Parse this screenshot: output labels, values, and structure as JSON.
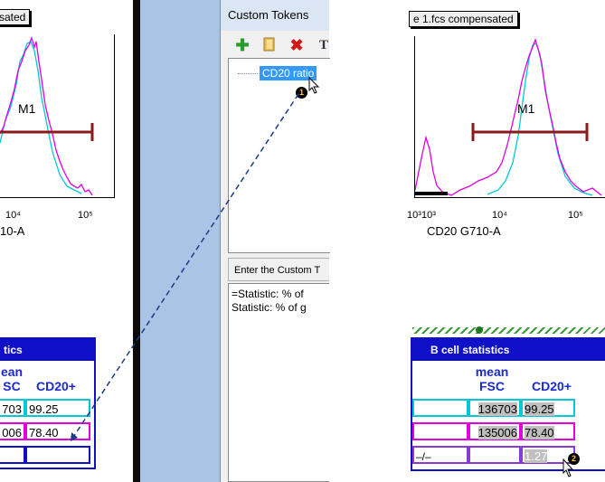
{
  "left_panel": {
    "label_text": "sated",
    "gate_label": "M1",
    "ticks": [
      "10⁴",
      "10⁵"
    ],
    "axis_label": "10-A",
    "stats": {
      "title": "tics",
      "col1": "ean\nSC",
      "col2": "CD20+",
      "rows": [
        {
          "c1": "703",
          "c2": "99.25"
        },
        {
          "c1": "006",
          "c2": "78.40"
        },
        {
          "c1": "",
          "c2": ""
        }
      ]
    }
  },
  "dialog": {
    "title": "Custom Tokens",
    "toolbar": [
      "add-icon",
      "open-icon",
      "delete-icon",
      "text-icon"
    ],
    "tree_item": "CD20 ratio",
    "badge_1": "1",
    "prompt": "Enter the Custom T",
    "text_lines": "=Statistic: % of\nStatistic: % of g"
  },
  "right_panel": {
    "label_text": "e 1.fcs compensated",
    "gate_label": "M1",
    "ticks": [
      "10³",
      "10³",
      "10⁴",
      "10⁵"
    ],
    "axis_label": "CD20 G710-A",
    "stats": {
      "title": "B cell statistics",
      "col1": "mean\nFSC",
      "col2": "CD20+",
      "rows": [
        {
          "c0": "",
          "c1": "136703",
          "c2": "99.25"
        },
        {
          "c0": "",
          "c1": "135006",
          "c2": "78.40"
        },
        {
          "c0": "–/–",
          "c1": "",
          "c2": "1.27"
        }
      ]
    },
    "badge_2": "2"
  },
  "colors": {
    "magenta": "#e000e0",
    "cyan": "#00c8d8",
    "gate": "#8b1a1a",
    "stats_blue": "#1010c8"
  }
}
